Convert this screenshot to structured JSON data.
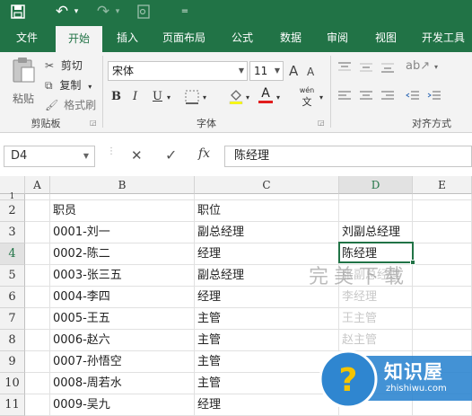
{
  "qat": {
    "save_icon": "save-icon",
    "undo_glyph": "↶",
    "redo_glyph": "↷",
    "more_glyph": "▾"
  },
  "tabs": [
    {
      "label": "文件"
    },
    {
      "label": "开始"
    },
    {
      "label": "插入"
    },
    {
      "label": "页面布局"
    },
    {
      "label": "公式"
    },
    {
      "label": "数据"
    },
    {
      "label": "审阅"
    },
    {
      "label": "视图"
    },
    {
      "label": "开发工具"
    }
  ],
  "ribbon": {
    "paste_label": "粘贴",
    "cut_label": "剪切",
    "copy_label": "复制",
    "format_painter_label": "格式刷",
    "clipboard_group": "剪贴板",
    "font_name": "宋体",
    "font_size": "11",
    "grow_font": "A",
    "shrink_font": "A",
    "bold": "B",
    "italic": "I",
    "underline": "U",
    "font_color_glyph": "A",
    "phonetic_label": "wén",
    "font_group": "字体",
    "alignment_group": "对齐方式",
    "font_color": "#e11d1d"
  },
  "formula_bar": {
    "name_box": "D4",
    "cancel_glyph": "✕",
    "enter_glyph": "✓",
    "fx_label": "fx",
    "content": "陈经理"
  },
  "grid": {
    "columns": [
      "A",
      "B",
      "C",
      "D",
      "E"
    ],
    "rows": [
      {
        "num": "1",
        "b": "",
        "c": "",
        "d": ""
      },
      {
        "num": "2",
        "b": "职员",
        "c": "职位",
        "d": ""
      },
      {
        "num": "3",
        "b": "0001-刘一",
        "c": "副总经理",
        "d": "刘副总经理"
      },
      {
        "num": "4",
        "b": "0002-陈二",
        "c": "经理",
        "d": "陈经理"
      },
      {
        "num": "5",
        "b": "0003-张三五",
        "c": "副总经理",
        "d": ""
      },
      {
        "num": "6",
        "b": "0004-李四",
        "c": "经理",
        "d": ""
      },
      {
        "num": "7",
        "b": "0005-王五",
        "c": "主管",
        "d": ""
      },
      {
        "num": "8",
        "b": "0006-赵六",
        "c": "主管",
        "d": ""
      },
      {
        "num": "9",
        "b": "0007-孙悟空",
        "c": "主管",
        "d": ""
      },
      {
        "num": "10",
        "b": "0008-周若水",
        "c": "主管",
        "d": ""
      },
      {
        "num": "11",
        "b": "0009-吴九",
        "c": "经理",
        "d": ""
      }
    ],
    "flash_fill_preview": [
      "张副总经理",
      "李经理",
      "王主管",
      "赵主管"
    ]
  },
  "watermark": "完美下载",
  "logo": {
    "title": "知识屋",
    "subtitle": "zhishiwu.com"
  },
  "accent": "#217346"
}
